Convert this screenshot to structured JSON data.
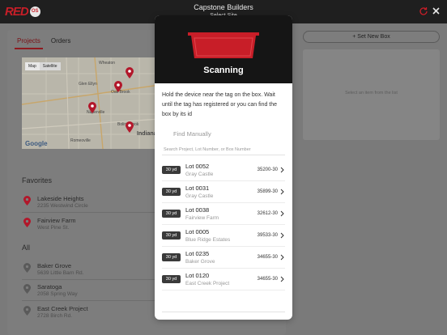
{
  "topbar": {
    "logo_text": "RED",
    "logo_badge": "OS",
    "title": "Capstone Builders",
    "subtitle": "Select Site",
    "colors": {
      "background": "#1f1f1f",
      "brand": "#c81e28"
    }
  },
  "left": {
    "tabs": [
      {
        "label": "Projects",
        "active": true
      },
      {
        "label": "Orders",
        "active": false
      }
    ],
    "map": {
      "toggle": [
        "Map",
        "Satellite"
      ],
      "attribution": "Google",
      "labels": [
        "Wheaton",
        "Glen Ellyn",
        "Oak Brook",
        "Naperville",
        "Bolingbrook",
        "Romeoville",
        "Indiana"
      ]
    },
    "favorites_heading": "Favorites",
    "favorites": [
      {
        "name": "Lakeside Heights",
        "address": "2235 Westwind Circle"
      },
      {
        "name": "Fairview Farm",
        "address": "West Pine St."
      }
    ],
    "all_heading": "All",
    "all": [
      {
        "name": "Baker Grove",
        "address": "5639 Little Barn Rd."
      },
      {
        "name": "Saratoga",
        "address": "2058 Spring Way"
      },
      {
        "name": "East Creek Project",
        "address": "2728 Birch Rd."
      }
    ]
  },
  "right": {
    "set_button": "+  Set New Box",
    "placeholder": "Select an item from the list"
  },
  "modal": {
    "title": "Scanning",
    "description": "Hold the device near the tag on the box. Wait until the tag has registered or you can find the box by its id",
    "find_manually": "Find Manually",
    "search_placeholder": "Search Project, Lot Number, or Box Number",
    "lots": [
      {
        "size": "30 yd",
        "name": "Lot 0052",
        "site": "Gray Castle",
        "id": "35200-30"
      },
      {
        "size": "30 yd",
        "name": "Lot 0031",
        "site": "Gray Castle",
        "id": "35899-30"
      },
      {
        "size": "30 yd",
        "name": "Lot 0038",
        "site": "Fairview Farm",
        "id": "32612-30"
      },
      {
        "size": "30 yd",
        "name": "Lot 0005",
        "site": "Blue Ridge Estates",
        "id": "39533-30"
      },
      {
        "size": "30 yd",
        "name": "Lot 0235",
        "site": "Baker Grove",
        "id": "34655-30"
      },
      {
        "size": "30 yd",
        "name": "Lot 0120",
        "site": "East Creek Project",
        "id": "34655-30"
      }
    ],
    "accent": "#c81e28"
  }
}
